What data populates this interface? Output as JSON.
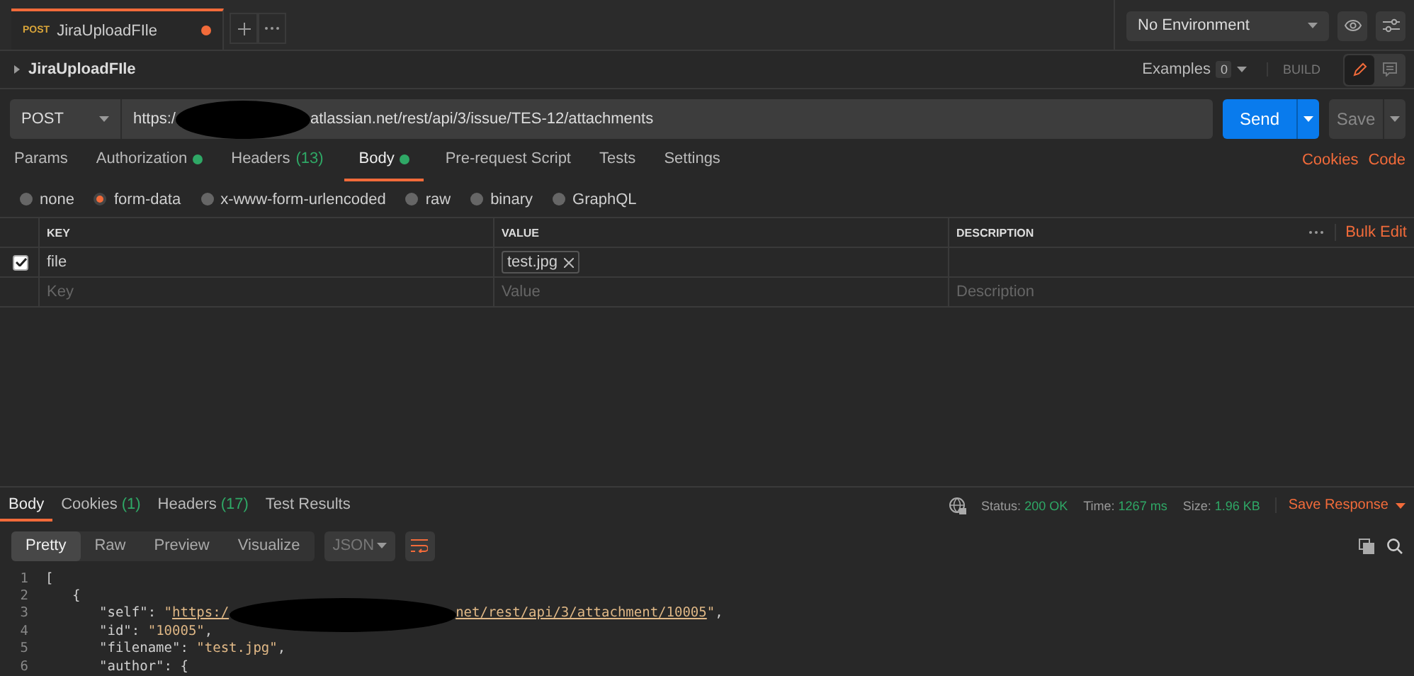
{
  "request_tabs": [
    {
      "method": "POST",
      "name": "JiraUploadFIle",
      "selected": true,
      "unsaved": true
    }
  ],
  "environment": {
    "value": "No Environment"
  },
  "request_name": "JiraUploadFIle",
  "examples": {
    "label": "Examples",
    "count": "0"
  },
  "mode_label": "BUILD",
  "url_bar": {
    "method": "POST",
    "url_start": "https:/",
    "url_end": "atlassian.net/rest/api/3/issue/TES-12/attachments",
    "send": "Send",
    "save": "Save"
  },
  "section_tabs": [
    {
      "label": "Params",
      "dot": false,
      "selected": false
    },
    {
      "label": "Authorization",
      "dot": true,
      "selected": false
    },
    {
      "label": "Headers",
      "count": "(13)",
      "dot": false,
      "selected": false
    },
    {
      "label": "Body",
      "dot": true,
      "selected": true
    },
    {
      "label": "Pre-request Script",
      "dot": false,
      "selected": false
    },
    {
      "label": "Tests",
      "dot": false,
      "selected": false
    },
    {
      "label": "Settings",
      "dot": false,
      "selected": false
    }
  ],
  "links": [
    "Cookies",
    "Code"
  ],
  "body_types": [
    {
      "label": "none",
      "selected": false
    },
    {
      "label": "form-data",
      "selected": true
    },
    {
      "label": "x-www-form-urlencoded",
      "selected": false
    },
    {
      "label": "raw",
      "selected": false
    },
    {
      "label": "binary",
      "selected": false
    },
    {
      "label": "GraphQL",
      "selected": false
    }
  ],
  "table": {
    "columns": [
      "KEY",
      "VALUE",
      "DESCRIPTION"
    ],
    "bulk_edit": "Bulk Edit",
    "rows": [
      {
        "checked": true,
        "key": "file",
        "file": "test.jpg",
        "description": ""
      }
    ],
    "new_row": [
      {
        "placeholder": "Key"
      },
      {
        "placeholder": "Value"
      },
      {
        "placeholder": "Description"
      }
    ]
  },
  "response_tabs": [
    {
      "label": "Body",
      "selected": true
    },
    {
      "label": "Cookies",
      "count": "(1)",
      "selected": false
    },
    {
      "label": "Headers",
      "count": "(17)",
      "selected": false
    },
    {
      "label": "Test Results",
      "selected": false
    }
  ],
  "status": [
    {
      "label": "Status:",
      "value": "200 OK"
    },
    {
      "label": "Time:",
      "value": "1267 ms"
    },
    {
      "label": "Size:",
      "value": "1.96 KB"
    }
  ],
  "save_response": "Save Response",
  "view_modes": [
    {
      "label": "Pretty",
      "selected": true
    },
    {
      "label": "Raw",
      "selected": false
    },
    {
      "label": "Preview",
      "selected": false
    },
    {
      "label": "Visualize",
      "selected": false
    }
  ],
  "format": "JSON",
  "code_lines": [
    {
      "number": "1",
      "parts": [
        {
          "kind": "punct",
          "text": "["
        }
      ],
      "children": [
        {
          "number": "2",
          "parts": [
            {
              "kind": "punct",
              "text": "{"
            }
          ],
          "children": [
            {
              "number": "3",
              "parts": [
                {
                  "kind": "key",
                  "text": "\"self\""
                },
                {
                  "kind": "punct",
                  "text": ": "
                },
                {
                  "kind": "string",
                  "text": "\""
                },
                {
                  "kind": "link",
                  "text": "https:/"
                },
                {
                  "kind": "redacted"
                },
                {
                  "kind": "link",
                  "text": "net/rest/api/3/attachment/10005"
                },
                {
                  "kind": "string",
                  "text": "\""
                },
                {
                  "kind": "punct",
                  "text": ","
                }
              ]
            },
            {
              "number": "4",
              "parts": [
                {
                  "kind": "key",
                  "text": "\"id\""
                },
                {
                  "kind": "punct",
                  "text": ": "
                },
                {
                  "kind": "string",
                  "text": "\"10005\""
                },
                {
                  "kind": "punct",
                  "text": ","
                }
              ]
            },
            {
              "number": "5",
              "parts": [
                {
                  "kind": "key",
                  "text": "\"filename\""
                },
                {
                  "kind": "punct",
                  "text": ": "
                },
                {
                  "kind": "string",
                  "text": "\"test.jpg\""
                },
                {
                  "kind": "punct",
                  "text": ","
                }
              ]
            },
            {
              "number": "6",
              "parts": [
                {
                  "kind": "key",
                  "text": "\"author\""
                },
                {
                  "kind": "punct",
                  "text": ": {"
                }
              ]
            }
          ]
        }
      ]
    }
  ]
}
